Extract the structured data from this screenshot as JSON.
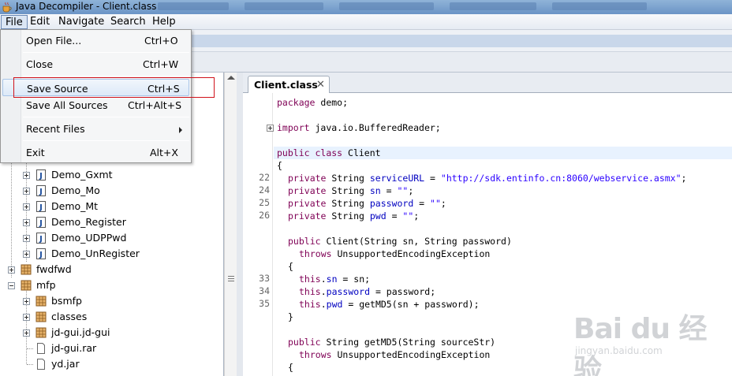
{
  "window": {
    "title": "Java Decompiler - Client.class"
  },
  "menubar": {
    "items": [
      "File",
      "Edit",
      "Navigate",
      "Search",
      "Help"
    ]
  },
  "file_menu": {
    "items": [
      {
        "label": "Open File...",
        "shortcut": "Ctrl+O"
      },
      {
        "label": "Close",
        "shortcut": "Ctrl+W"
      },
      {
        "label": "Save Source",
        "shortcut": "Ctrl+S"
      },
      {
        "label": "Save All Sources",
        "shortcut": "Ctrl+Alt+S"
      },
      {
        "label": "Recent Files",
        "shortcut": ""
      },
      {
        "label": "Exit",
        "shortcut": "Alt+X"
      }
    ]
  },
  "tree": {
    "items": [
      {
        "label": "Demo_Gxmt",
        "icon": "java-file-icon"
      },
      {
        "label": "Demo_Mo",
        "icon": "java-file-icon"
      },
      {
        "label": "Demo_Mt",
        "icon": "java-file-icon"
      },
      {
        "label": "Demo_Register",
        "icon": "java-file-icon"
      },
      {
        "label": "Demo_UDPPwd",
        "icon": "java-file-icon"
      },
      {
        "label": "Demo_UnRegister",
        "icon": "java-file-icon"
      },
      {
        "label": "fwdfwd",
        "icon": "package-icon"
      },
      {
        "label": "mfp",
        "icon": "package-icon"
      },
      {
        "label": "bsmfp",
        "icon": "package-icon"
      },
      {
        "label": "classes",
        "icon": "package-icon"
      },
      {
        "label": "jd-gui.jd-gui",
        "icon": "package-icon"
      },
      {
        "label": "jd-gui.rar",
        "icon": "file-icon"
      },
      {
        "label": "yd.jar",
        "icon": "file-icon"
      }
    ]
  },
  "editor": {
    "tab_label": "Client.class",
    "line_numbers": [
      "22",
      "24",
      "25",
      "26",
      "33",
      "34",
      "35"
    ],
    "code": {
      "package_kw": "package",
      "package_name": " demo;",
      "import_kw": "import",
      "import_name": " java.io.BufferedReader;",
      "public_kw": "public",
      "class_kw": "class",
      "class_name": " Client",
      "open_brace": "{",
      "close_brace": "}",
      "private_kw": "private",
      "string_type": " String ",
      "f_serviceURL": "serviceURL",
      "f_sn": "sn",
      "f_password": "password",
      "f_pwd": "pwd",
      "eq": " = ",
      "s_url": "\"http://sdk.entinfo.cn:8060/webservice.asmx\"",
      "s_empty": "\"\"",
      "semi": ";",
      "ctor_sig": " Client(String sn, String password)",
      "throws_kw": "throws",
      "exc": " UnsupportedEncodingException",
      "this_kw": "this",
      "dot": ".",
      "assign_sn": " = sn;",
      "assign_password": " = password;",
      "assign_pwd": " = getMD5(sn + password);",
      "method_sig": " String getMD5(String sourceStr)"
    }
  },
  "watermark": {
    "line1": "Bai du 经验",
    "line2": "jingyan.baidu.com"
  }
}
